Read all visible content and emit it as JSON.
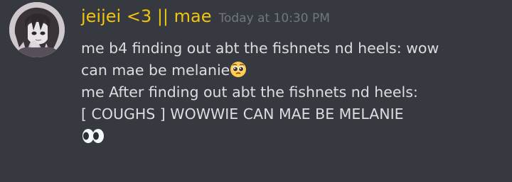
{
  "message": {
    "author": "jeijei <3 || mae",
    "timestamp": "Today at 10:30 PM",
    "author_color": "#f1c40f",
    "lines": [
      {
        "text": "me b4 finding out abt the fishnets nd heels: wow"
      },
      {
        "text": "can mae be melanie",
        "trailing_emoji": "pleading-face-emoji"
      },
      {
        "text": "me After finding out abt the fishnets nd heels:"
      },
      {
        "text": "[ COUGHS ] WOWWIE CAN MAE BE MELANIE"
      },
      {
        "text": "",
        "trailing_emoji": "eyes-emoji"
      }
    ]
  },
  "colors": {
    "background": "#36393f",
    "text": "#dcddde",
    "timestamp": "#72767d"
  }
}
